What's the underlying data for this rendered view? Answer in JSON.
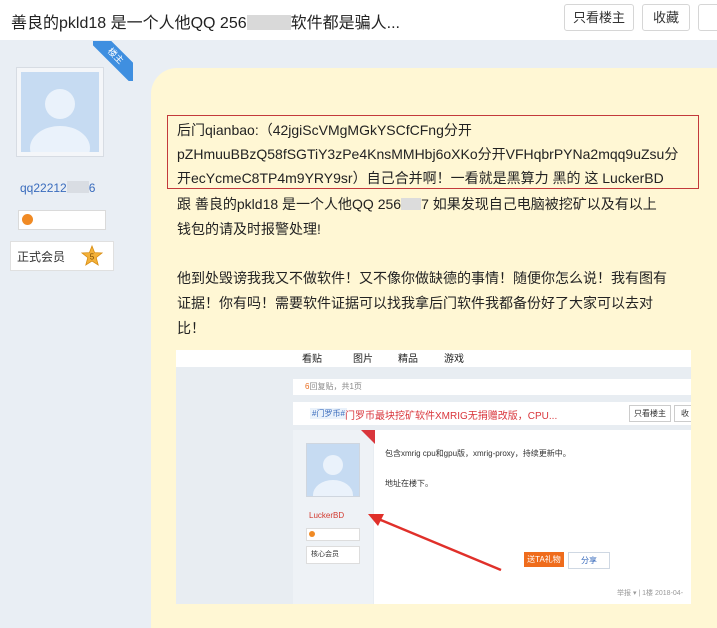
{
  "header": {
    "title_prefix": "善良的pkld18 是一个人他QQ 256",
    "title_suffix": "软件都是骗人...",
    "btn_only_op": "只看楼主",
    "btn_favorite": "收藏"
  },
  "user": {
    "name_prefix": "qq22212",
    "name_suffix": "6",
    "member_label": "正式会员",
    "member_level": "5",
    "op_badge": "楼主"
  },
  "post": {
    "lines": [
      "后门qianbao:（42jgiScVMgMGkYSCfCFng分开",
      "pZHmuuBBzQ58fSGTiY3zPe4KnsMMHbj6oXKo分开VFHqbrPYNa2mqq9uZsu分",
      "开ecYcmeC8TP4m9YRY9sr）自己合并啊！一看就是黑算力 黑的 这 LuckerBD",
      "如果发现自己电脑被挖矿以及有以上",
      "钱包的请及时报警处理!",
      "他到处毁谤我我又不做软件！又不像你做缺德的事情！随便你怎么说！我有图有",
      "证据！你有吗！需要软件证据可以找我拿后门软件我都备份好了大家可以去对",
      "比！"
    ],
    "line4_prefix": "跟 善良的pkld18 是一个人他QQ 256",
    "line4_mid": "7"
  },
  "screenshot": {
    "nav": [
      "看贴",
      "图片",
      "精品",
      "游戏"
    ],
    "reply_info_count": "6",
    "reply_info_text": "回复贴，共1页",
    "tag": "#门罗币#",
    "title": "门罗币最块挖矿软件XMRIG无捐赠改版，CPU...",
    "btn_only_op": "只看楼主",
    "btn_fav": "收",
    "op_badge": "楼主",
    "content_line1": "包含xmrig cpu和gpu版，xmrig-proxy，持续更新中。",
    "content_line2": "地址在楼下。",
    "username": "LuckerBD",
    "member": "核心会员",
    "reply_btn": "送TA礼物",
    "share_btn": "分享",
    "footer": "举报 ▾ | 1楼  2018-04-"
  },
  "colors": {
    "background": "#e9eef4",
    "post_bg": "#fff7d4",
    "highlight_border": "#c3393b",
    "link": "#3a6cbd"
  }
}
